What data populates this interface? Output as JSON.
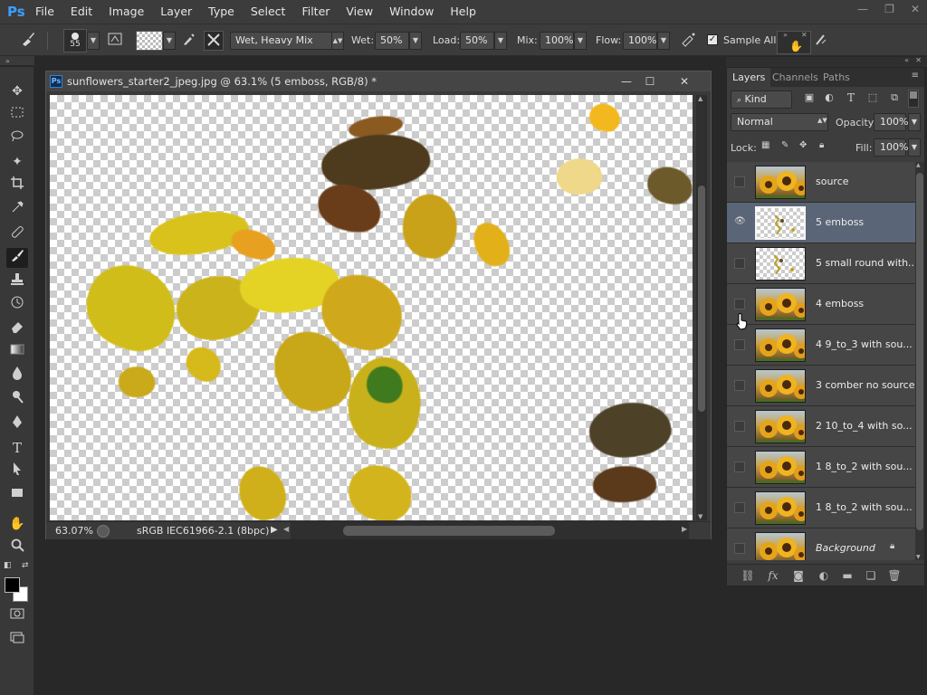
{
  "app": {
    "logo": "Ps"
  },
  "menu": [
    "File",
    "Edit",
    "Image",
    "Layer",
    "Type",
    "Select",
    "Filter",
    "View",
    "Window",
    "Help"
  ],
  "window_controls": {
    "minimize": "—",
    "restore": "❐",
    "close": "✕"
  },
  "options_bar": {
    "brush_size": "55",
    "mixer_preset": "Wet, Heavy Mix",
    "wet_label": "Wet:",
    "wet_value": "50%",
    "load_label": "Load:",
    "load_value": "50%",
    "mix_label": "Mix:",
    "mix_value": "100%",
    "flow_label": "Flow:",
    "flow_value": "100%",
    "sample_all_label": "Sample All La"
  },
  "document": {
    "title": "sunflowers_starter2_jpeg.jpg @ 63.1% (5 emboss, RGB/8) *",
    "zoom": "63.07%",
    "color_profile": "sRGB IEC61966-2.1 (8bpc)"
  },
  "layers_panel": {
    "tabs": [
      "Layers",
      "Channels",
      "Paths"
    ],
    "active_tab": "Layers",
    "filter_kind": "Kind",
    "blend_mode": "Normal",
    "opacity_label": "Opacity:",
    "opacity_value": "100%",
    "lock_label": "Lock:",
    "fill_label": "Fill:",
    "fill_value": "100%",
    "layers": [
      {
        "name": "source",
        "thumb": "sun",
        "visible": false,
        "selected": false
      },
      {
        "name": "5 emboss",
        "thumb": "trans",
        "visible": true,
        "selected": true
      },
      {
        "name": "5 small round with...",
        "thumb": "trans",
        "visible": false,
        "selected": false
      },
      {
        "name": "4 emboss",
        "thumb": "sun",
        "visible": false,
        "selected": false
      },
      {
        "name": "4 9_to_3 with sou...",
        "thumb": "sun",
        "visible": false,
        "selected": false
      },
      {
        "name": "3 comber no source",
        "thumb": "sun",
        "visible": false,
        "selected": false
      },
      {
        "name": "2 10_to_4 with so...",
        "thumb": "sun",
        "visible": false,
        "selected": false
      },
      {
        "name": "1 8_to_2 with sou...",
        "thumb": "sun",
        "visible": false,
        "selected": false
      },
      {
        "name": "1 8_to_2 with sou...",
        "thumb": "sun",
        "visible": false,
        "selected": false
      },
      {
        "name": "Background",
        "thumb": "sun",
        "visible": false,
        "selected": false,
        "locked": true
      }
    ]
  },
  "colors": {
    "foreground": "#000000",
    "background": "#ffffff",
    "selection": "#5a6677"
  }
}
